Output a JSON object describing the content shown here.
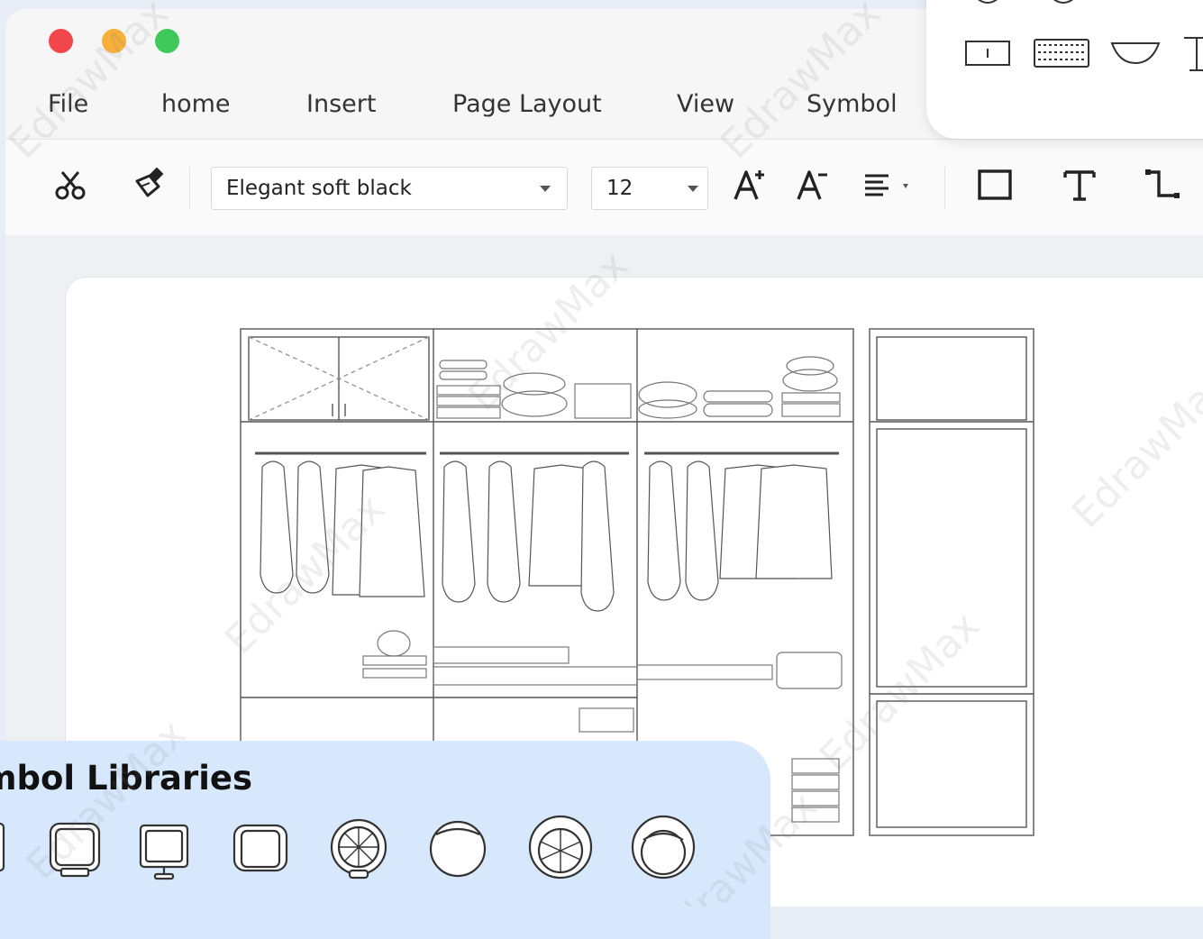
{
  "menu": {
    "file": "File",
    "home": "home",
    "insert": "Insert",
    "page_layout": "Page Layout",
    "view": "View",
    "symbol": "Symbol"
  },
  "toolbar": {
    "font_name": "Elegant soft black",
    "font_size": "12"
  },
  "library_panel": {
    "title": "Symbol Libraries"
  },
  "watermark": "EdrawMax",
  "icons": [
    "cut-icon",
    "format-painter-icon",
    "increase-font-icon",
    "decrease-font-icon",
    "align-icon",
    "rectangle-icon",
    "text-icon",
    "connector-icon"
  ]
}
